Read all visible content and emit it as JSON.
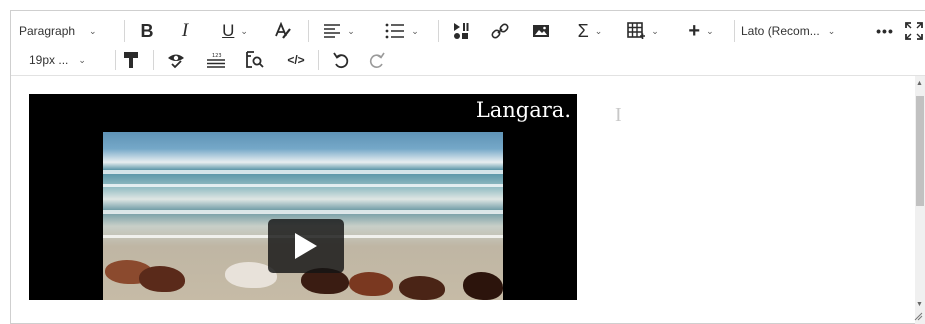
{
  "toolbar": {
    "block_format": "Paragraph",
    "font_family": "Lato (Recom...",
    "font_size": "19px ...",
    "icons": [
      "bold-icon",
      "italic-icon",
      "underline-icon",
      "text-color-icon",
      "align-icon",
      "list-icon",
      "media-icon",
      "link-icon",
      "image-icon",
      "equation-icon",
      "table-icon",
      "insert-icon",
      "more-icon",
      "fullscreen-icon",
      "format-painter-icon",
      "accessibility-icon",
      "word-count-icon",
      "find-replace-icon",
      "source-code-icon",
      "undo-icon",
      "redo-icon"
    ]
  },
  "content": {
    "video": {
      "brand": "Langara."
    }
  },
  "colors": {
    "icon": "#2b2b2b",
    "border": "#cfcfcf",
    "video_bg": "#000000"
  }
}
